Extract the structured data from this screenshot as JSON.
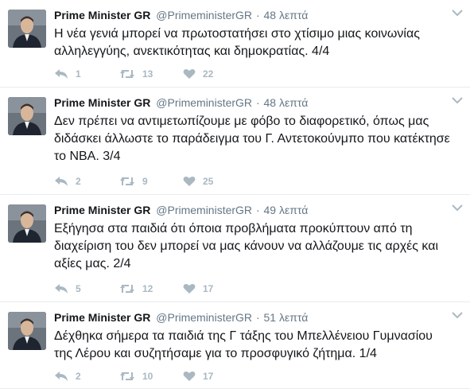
{
  "tweets": [
    {
      "name": "Prime Minister GR",
      "handle": "@PrimeministerGR",
      "separator": "·",
      "time": "48 λεπτά",
      "text": "Η νέα γενιά μπορεί να πρωτοστατήσει στο χτίσιμο μιας κοινωνίας αλληλεγγύης, ανεκτικότητας και δημοκρατίας. 4/4",
      "replies": "1",
      "retweets": "13",
      "likes": "22"
    },
    {
      "name": "Prime Minister GR",
      "handle": "@PrimeministerGR",
      "separator": "·",
      "time": "48 λεπτά",
      "text": "Δεν πρέπει να αντιμετωπίζουμε με φόβο το διαφορετικό, όπως μας διδάσκει άλλωστε το παράδειγμα του Γ. Αντετοκούνμπο που κατέκτησε το NBA. 3/4",
      "replies": "2",
      "retweets": "9",
      "likes": "25"
    },
    {
      "name": "Prime Minister GR",
      "handle": "@PrimeministerGR",
      "separator": "·",
      "time": "49 λεπτά",
      "text": "Εξήγησα στα παιδιά ότι όποια προβλήματα προκύπτουν από τη διαχείριση του δεν μπορεί να μας κάνουν να αλλάζουμε τις αρχές και αξίες μας. 2/4",
      "replies": "5",
      "retweets": "12",
      "likes": "17"
    },
    {
      "name": "Prime Minister GR",
      "handle": "@PrimeministerGR",
      "separator": "·",
      "time": "51 λεπτά",
      "text": "Δέχθηκα σήμερα τα παιδιά της Γ τάξης του Μπελλένειου Γυμνασίου της Λέρου και συζητήσαμε για το προσφυγικό ζήτημα. 1/4",
      "replies": "2",
      "retweets": "10",
      "likes": "17"
    }
  ],
  "colors": {
    "text": "#14171a",
    "muted": "#657786",
    "action_gray": "#aab8c2",
    "divider": "#e6ecf0"
  },
  "icons": {
    "reply": "reply-arrow-icon",
    "retweet": "retweet-arrows-icon",
    "like": "heart-icon",
    "menu": "chevron-down-icon",
    "avatar": "profile-photo"
  }
}
